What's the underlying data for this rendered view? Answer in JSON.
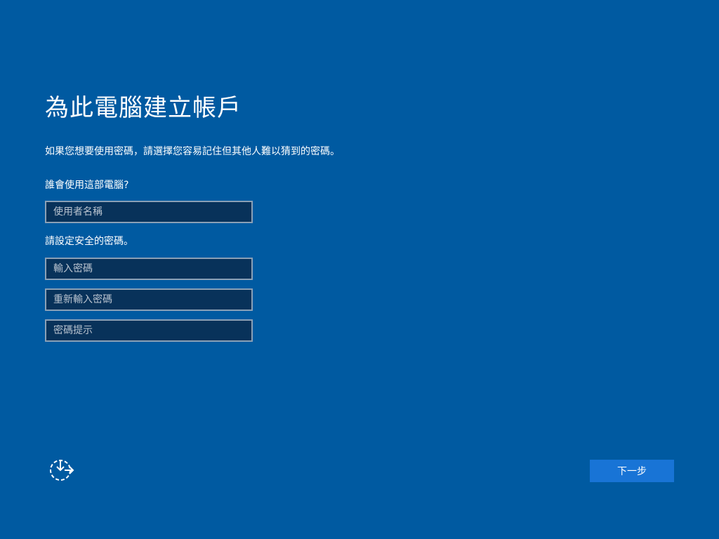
{
  "header": {
    "title": "為此電腦建立帳戶",
    "subtitle": "如果您想要使用密碼，請選擇您容易記住但其他人難以猜到的密碼。"
  },
  "form": {
    "who_label": "誰會使用這部電腦?",
    "username_placeholder": "使用者名稱",
    "password_label": "請設定安全的密碼。",
    "password_placeholder": "輸入密碼",
    "reenter_placeholder": "重新輸入密碼",
    "hint_placeholder": "密碼提示"
  },
  "footer": {
    "ease_of_access_icon": "ease-of-access-icon",
    "next_label": "下一步"
  },
  "colors": {
    "background": "#005aa1",
    "field_background": "#08325a",
    "field_border": "#8aa0b6",
    "button": "#1874d6"
  }
}
